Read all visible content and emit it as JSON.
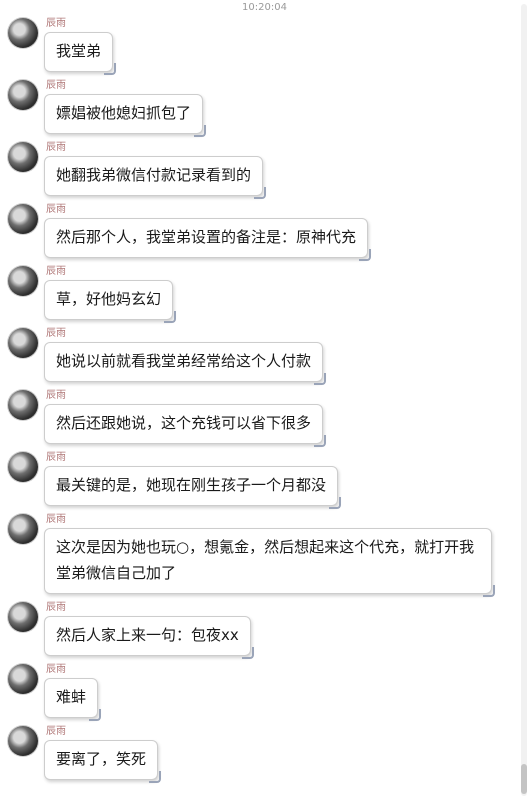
{
  "timestamp": "10:20:04",
  "sender_name": "辰雨",
  "messages": [
    {
      "text": "我堂弟"
    },
    {
      "text": "嫖娼被他媳妇抓包了"
    },
    {
      "text": "她翻我弟微信付款记录看到的"
    },
    {
      "text": "然后那个人，我堂弟设置的备注是：原神代充"
    },
    {
      "text": "草，好他妈玄幻"
    },
    {
      "text": "她说以前就看我堂弟经常给这个人付款"
    },
    {
      "text": "然后还跟她说，这个充钱可以省下很多"
    },
    {
      "text": "最关键的是，她现在刚生孩子一个月都没"
    },
    {
      "text": "这次是因为她也玩○，想氪金，然后想起来这个代充，就打开我堂弟微信自己加了"
    },
    {
      "text": "然后人家上来一句：包夜xx"
    },
    {
      "text": "难蚌"
    },
    {
      "text": "要离了，笑死"
    }
  ]
}
